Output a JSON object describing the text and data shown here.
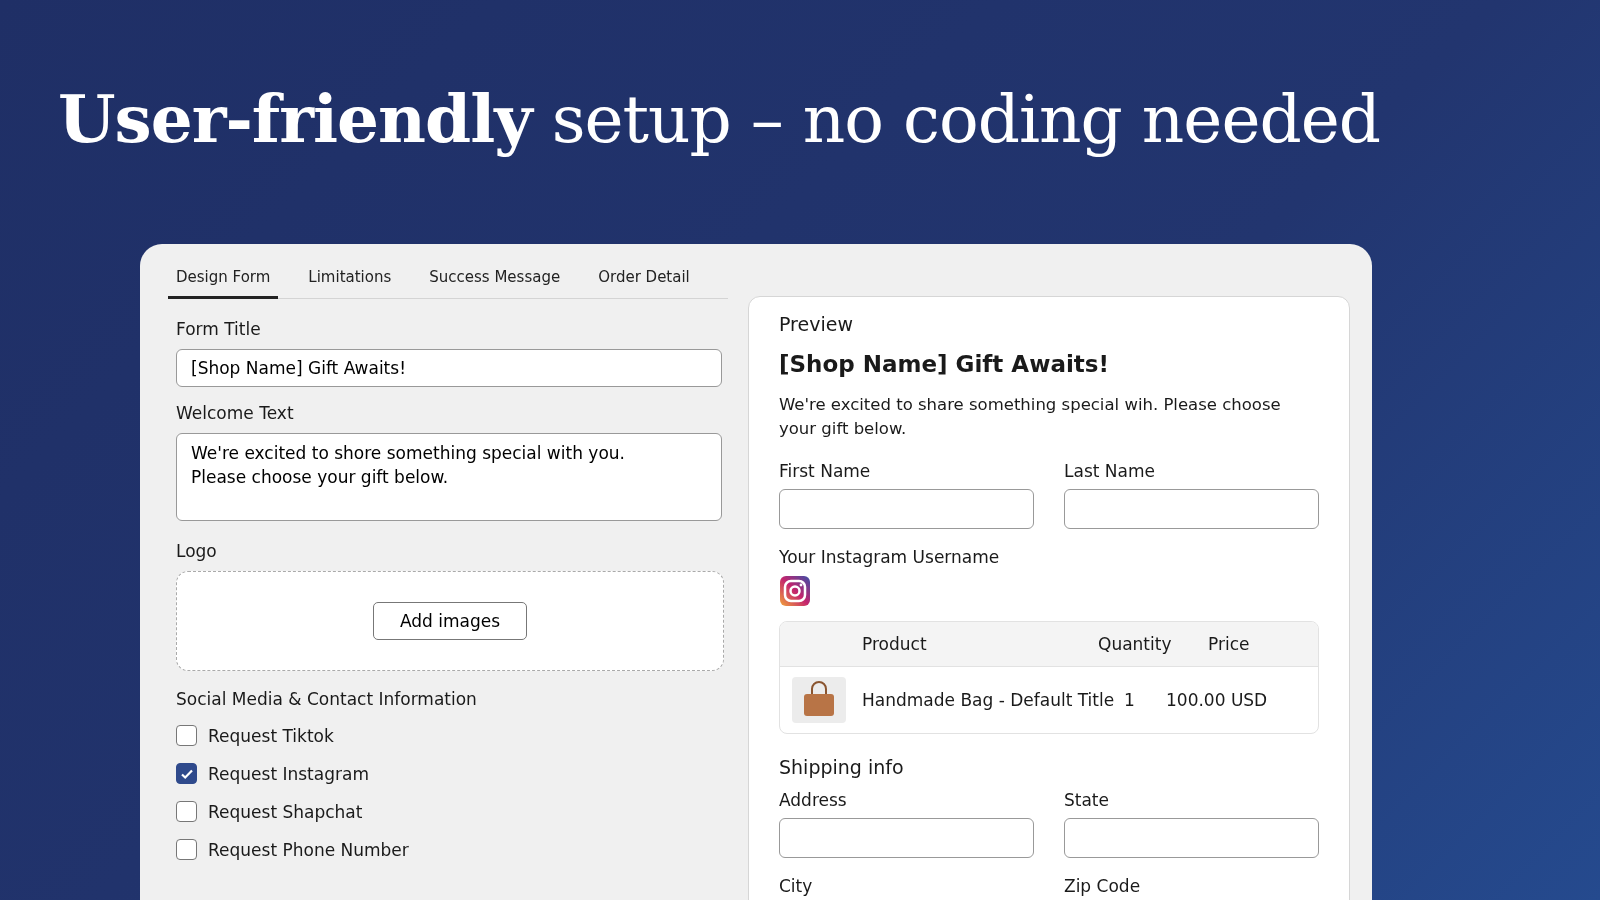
{
  "headline": "**User-friendly** setup – no coding needed",
  "tabs": [
    {
      "label": "Design Form",
      "selected": true
    },
    {
      "label": "Limitations",
      "selected": false
    },
    {
      "label": "Success Message",
      "selected": false
    },
    {
      "label": "Order Detail",
      "selected": false
    }
  ],
  "form": {
    "title_label": "Form Title",
    "title_value": "[Shop Name] Gift Awaits!",
    "welcome_label": "Welcome Text",
    "welcome_value": "We're excited to shore something special with you.\nPlease choose your gift below.",
    "logo_label": "Logo",
    "add_images": "Add images",
    "social_heading": "Social Media & Contact Information",
    "options": [
      {
        "label": "Request Tiktok",
        "checked": false
      },
      {
        "label": "Request Instagram",
        "checked": true
      },
      {
        "label": "Request Shapchat",
        "checked": false
      },
      {
        "label": "Request Phone Number",
        "checked": false
      }
    ]
  },
  "preview": {
    "heading": "Preview",
    "title": "[Shop Name] Gift Awaits!",
    "text": "We're excited to share something special wih. Please choose your gift below.",
    "name_fields": [
      "First Name",
      "Last Name"
    ],
    "instagram_label": "Your Instagram Username",
    "table": {
      "columns": [
        "Product",
        "Quantity",
        "Price"
      ],
      "rows": [
        {
          "product": "Handmade Bag - Default Title",
          "quantity": "1",
          "price": "100.00 USD"
        }
      ]
    },
    "shipping_heading": "Shipping info",
    "shipping_fields": [
      "Address",
      "State"
    ],
    "more_fields": [
      "City",
      "Zip Code"
    ]
  }
}
